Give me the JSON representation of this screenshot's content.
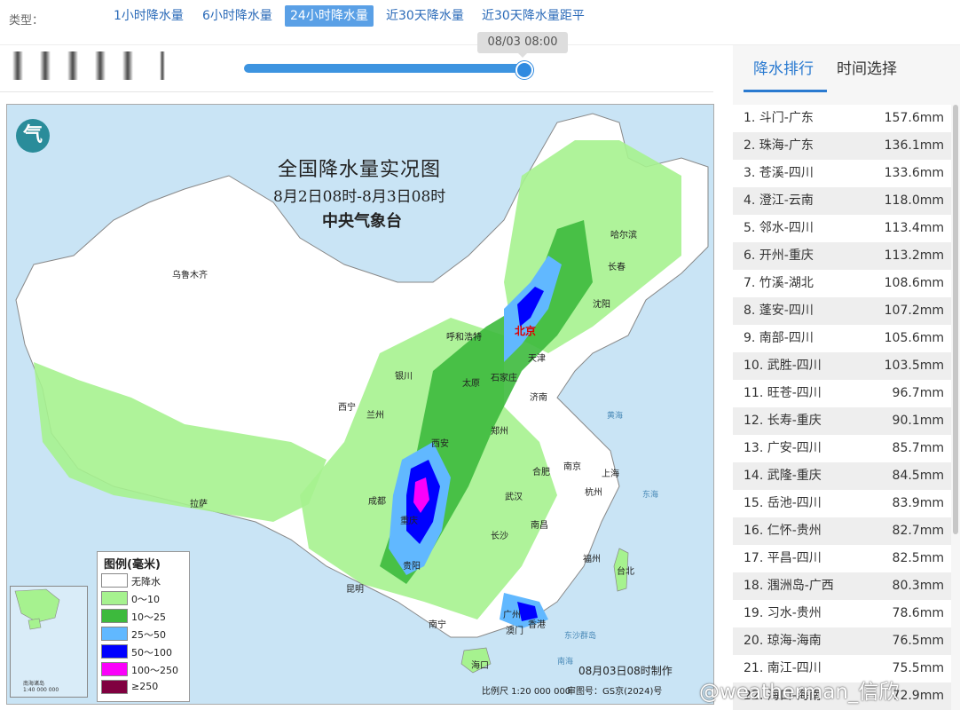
{
  "header": {
    "type_label": "类型：",
    "tabs": [
      {
        "label": "1小时降水量"
      },
      {
        "label": "6小时降水量"
      },
      {
        "label": "24小时降水量",
        "active": true
      },
      {
        "label": "近30天降水量"
      },
      {
        "label": "近30天降水量距平"
      }
    ]
  },
  "timeline": {
    "current": "08/03 08:00",
    "progress": 1.0
  },
  "map": {
    "title": "全国降水量实况图",
    "subtitle": "8月2日08时-8月3日08时",
    "org": "中央气象台",
    "logo_glyph": "气",
    "cities": [
      {
        "name": "乌鲁木齐"
      },
      {
        "name": "哈尔滨"
      },
      {
        "name": "长春"
      },
      {
        "name": "沈阳"
      },
      {
        "name": "呼和浩特"
      },
      {
        "name": "北京",
        "capital": true
      },
      {
        "name": "天津"
      },
      {
        "name": "银川"
      },
      {
        "name": "太原"
      },
      {
        "name": "石家庄"
      },
      {
        "name": "济南"
      },
      {
        "name": "西宁"
      },
      {
        "name": "兰州"
      },
      {
        "name": "西安"
      },
      {
        "name": "郑州"
      },
      {
        "name": "合肥"
      },
      {
        "name": "南京"
      },
      {
        "name": "上海"
      },
      {
        "name": "成都"
      },
      {
        "name": "武汉"
      },
      {
        "name": "杭州"
      },
      {
        "name": "拉萨"
      },
      {
        "name": "重庆"
      },
      {
        "name": "长沙"
      },
      {
        "name": "南昌"
      },
      {
        "name": "贵阳"
      },
      {
        "name": "福州"
      },
      {
        "name": "台北"
      },
      {
        "name": "昆明"
      },
      {
        "name": "南宁"
      },
      {
        "name": "广州"
      },
      {
        "name": "香港"
      },
      {
        "name": "澳门"
      },
      {
        "name": "海口"
      }
    ],
    "seas": [
      {
        "name": "黄海"
      },
      {
        "name": "东海"
      },
      {
        "name": "南海"
      },
      {
        "name": "东沙群岛"
      }
    ],
    "legend": {
      "title": "图例(毫米)",
      "items": [
        {
          "label": "无降水",
          "color": "#ffffff"
        },
        {
          "label": "0～10",
          "color": "#a6f28f"
        },
        {
          "label": "10～25",
          "color": "#3dba3d"
        },
        {
          "label": "25～50",
          "color": "#61b8ff"
        },
        {
          "label": "50～100",
          "color": "#0000ff"
        },
        {
          "label": "100～250",
          "color": "#fa00fa"
        },
        {
          "label": "≥250",
          "color": "#800040"
        }
      ]
    },
    "inset_label": "南海诸岛\n1:40 000 000",
    "made_time": "08月03日08时制作",
    "scale": "比例尺 1:20 000 000",
    "audit": "审图号：GS京(2024)号"
  },
  "sidebar": {
    "tabs": [
      {
        "label": "降水排行",
        "active": true
      },
      {
        "label": "时间选择"
      }
    ],
    "ranking": [
      {
        "name": "1. 斗门-广东",
        "value": "157.6mm"
      },
      {
        "name": "2. 珠海-广东",
        "value": "136.1mm"
      },
      {
        "name": "3. 苍溪-四川",
        "value": "133.6mm"
      },
      {
        "name": "4. 澄江-云南",
        "value": "118.0mm"
      },
      {
        "name": "5. 邻水-四川",
        "value": "113.4mm"
      },
      {
        "name": "6. 开州-重庆",
        "value": "113.2mm"
      },
      {
        "name": "7. 竹溪-湖北",
        "value": "108.6mm"
      },
      {
        "name": "8. 蓬安-四川",
        "value": "107.2mm"
      },
      {
        "name": "9. 南部-四川",
        "value": "105.6mm"
      },
      {
        "name": "10. 武胜-四川",
        "value": "103.5mm"
      },
      {
        "name": "11. 旺苍-四川",
        "value": "96.7mm"
      },
      {
        "name": "12. 长寿-重庆",
        "value": "90.1mm"
      },
      {
        "name": "13. 广安-四川",
        "value": "85.7mm"
      },
      {
        "name": "14. 武隆-重庆",
        "value": "84.5mm"
      },
      {
        "name": "15. 岳池-四川",
        "value": "83.9mm"
      },
      {
        "name": "16. 仁怀-贵州",
        "value": "82.7mm"
      },
      {
        "name": "17. 平昌-四川",
        "value": "82.5mm"
      },
      {
        "name": "18. 涠洲岛-广西",
        "value": "80.3mm"
      },
      {
        "name": "19. 习水-贵州",
        "value": "78.6mm"
      },
      {
        "name": "20. 琼海-海南",
        "value": "76.5mm"
      },
      {
        "name": "21. 南江-四川",
        "value": "75.5mm"
      },
      {
        "name": "22. 海口-海南",
        "value": "72.9mm"
      }
    ]
  },
  "watermark": "@weatherman_信欣"
}
